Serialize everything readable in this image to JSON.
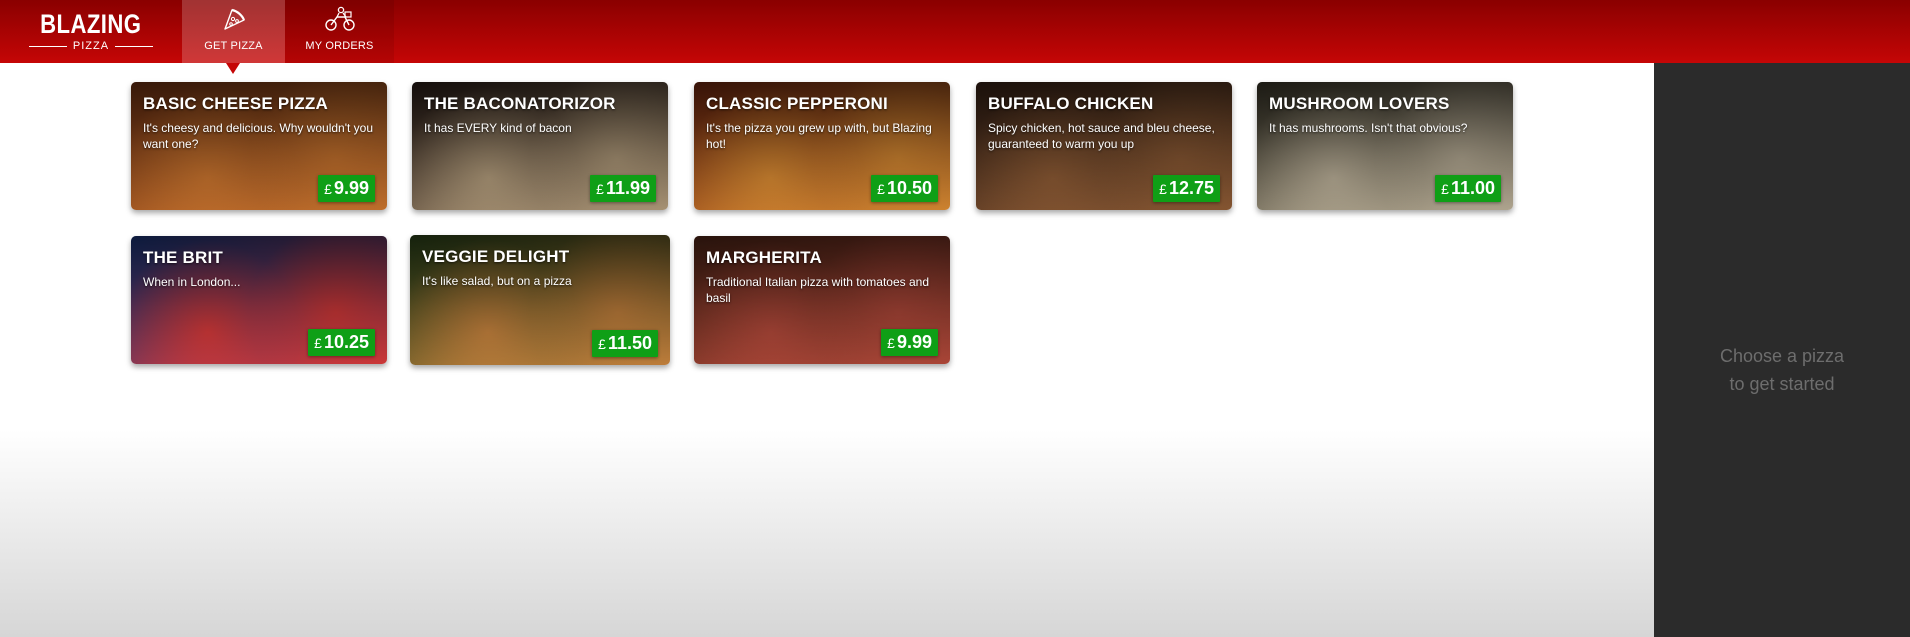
{
  "header": {
    "logo_main": "BLAZING",
    "logo_sub": "PIZZA",
    "tabs": [
      {
        "label": "GET PIZZA",
        "icon": "pizza-slice-icon",
        "active": true
      },
      {
        "label": "MY ORDERS",
        "icon": "delivery-bike-icon",
        "active": false
      }
    ]
  },
  "currency_symbol": "£",
  "pizzas": [
    {
      "name": "BASIC CHEESE PIZZA",
      "description": "It's cheesy and delicious. Why wouldn't you want one?",
      "price": "9.99",
      "image_colors": [
        "#7a3614",
        "#c9742e"
      ]
    },
    {
      "name": "THE BACONATORIZOR",
      "description": "It has EVERY kind of bacon",
      "price": "11.99",
      "image_colors": [
        "#2c1e18",
        "#b09a7a"
      ]
    },
    {
      "name": "CLASSIC PEPPERONI",
      "description": "It's the pizza you grew up with, but Blazing hot!",
      "price": "10.50",
      "image_colors": [
        "#7a2a10",
        "#d88a32"
      ]
    },
    {
      "name": "BUFFALO CHICKEN",
      "description": "Spicy chicken, hot sauce and bleu cheese, guaranteed to warm you up",
      "price": "12.75",
      "image_colors": [
        "#3b2418",
        "#8c5a34"
      ]
    },
    {
      "name": "MUSHROOM LOVERS",
      "description": "It has mushrooms. Isn't that obvious?",
      "price": "11.00",
      "image_colors": [
        "#3e3a2c",
        "#b8ad96"
      ]
    },
    {
      "name": "THE BRIT",
      "description": "When in London...",
      "price": "10.25",
      "image_colors": [
        "#1c3a86",
        "#d73a3a"
      ]
    },
    {
      "name": "VEGGIE DELIGHT",
      "description": "It's like salad, but on a pizza",
      "price": "11.50",
      "image_colors": [
        "#2f4a1c",
        "#c8843e"
      ]
    },
    {
      "name": "MARGHERITA",
      "description": "Traditional Italian pizza with tomatoes and basil",
      "price": "9.99",
      "image_colors": [
        "#5a2a1a",
        "#b3493a"
      ]
    }
  ],
  "sidebar": {
    "line1": "Choose a pizza",
    "line2": "to get started"
  },
  "colors": {
    "header_top": "#8a0000",
    "header_bottom": "#c50606",
    "price_badge": "#0f9f16",
    "sidebar_bg": "#2b2b2b"
  }
}
